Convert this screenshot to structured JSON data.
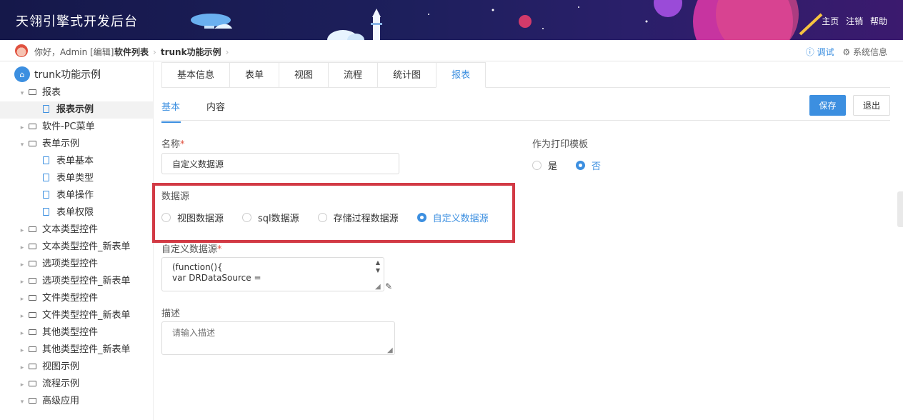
{
  "header": {
    "title": "天翎引擎式开发后台",
    "links": [
      "主页",
      "注销",
      "帮助"
    ]
  },
  "crumbbar": {
    "greeting": "你好，Admin [编辑]",
    "crumbs": [
      "软件列表",
      "trunk功能示例"
    ],
    "debug": "ⓘ 调试",
    "sysinfo": "⚙ 系统信息"
  },
  "sidebar": {
    "root": "trunk功能示例",
    "items": [
      {
        "label": "报表",
        "type": "folder",
        "expanded": true,
        "level": 1
      },
      {
        "label": "报表示例",
        "type": "doc",
        "level": 2,
        "selected": true
      },
      {
        "label": "软件-PC菜单",
        "type": "folder",
        "expanded": false,
        "level": 1
      },
      {
        "label": "表单示例",
        "type": "folder",
        "expanded": true,
        "level": 1
      },
      {
        "label": "表单基本",
        "type": "doc",
        "level": 2
      },
      {
        "label": "表单类型",
        "type": "doc",
        "level": 2
      },
      {
        "label": "表单操作",
        "type": "doc",
        "level": 2
      },
      {
        "label": "表单权限",
        "type": "doc",
        "level": 2
      },
      {
        "label": "文本类型控件",
        "type": "folder",
        "expanded": false,
        "level": 1
      },
      {
        "label": "文本类型控件_新表单",
        "type": "folder",
        "expanded": false,
        "level": 1
      },
      {
        "label": "选项类型控件",
        "type": "folder",
        "expanded": false,
        "level": 1
      },
      {
        "label": "选项类型控件_新表单",
        "type": "folder",
        "expanded": false,
        "level": 1
      },
      {
        "label": "文件类型控件",
        "type": "folder",
        "expanded": false,
        "level": 1
      },
      {
        "label": "文件类型控件_新表单",
        "type": "folder",
        "expanded": false,
        "level": 1
      },
      {
        "label": "其他类型控件",
        "type": "folder",
        "expanded": false,
        "level": 1
      },
      {
        "label": "其他类型控件_新表单",
        "type": "folder",
        "expanded": false,
        "level": 1
      },
      {
        "label": "视图示例",
        "type": "folder",
        "expanded": false,
        "level": 1
      },
      {
        "label": "流程示例",
        "type": "folder",
        "expanded": false,
        "level": 1
      },
      {
        "label": "高级应用",
        "type": "folder",
        "expanded": true,
        "level": 1
      }
    ]
  },
  "tabs": [
    "基本信息",
    "表单",
    "视图",
    "流程",
    "统计图",
    "报表"
  ],
  "active_tab": "报表",
  "subtabs": [
    "基本",
    "内容"
  ],
  "active_subtab": "基本",
  "buttons": {
    "save": "保存",
    "exit": "退出"
  },
  "form": {
    "name_label": "名称",
    "name_value": "自定义数据源",
    "print_label": "作为打印模板",
    "print_options": [
      "是",
      "否"
    ],
    "print_selected": "否",
    "datasource_label": "数据源",
    "datasource_options": [
      "视图数据源",
      "sql数据源",
      "存储过程数据源",
      "自定义数据源"
    ],
    "datasource_selected": "自定义数据源",
    "custom_label": "自定义数据源",
    "custom_code": [
      "(function(){",
      " var DRDataSource ="
    ],
    "desc_label": "描述",
    "desc_placeholder": "请输入描述"
  },
  "colors": {
    "accent": "#3c8fe0",
    "highlight": "#d23a45",
    "header": "#1d1f5c"
  }
}
